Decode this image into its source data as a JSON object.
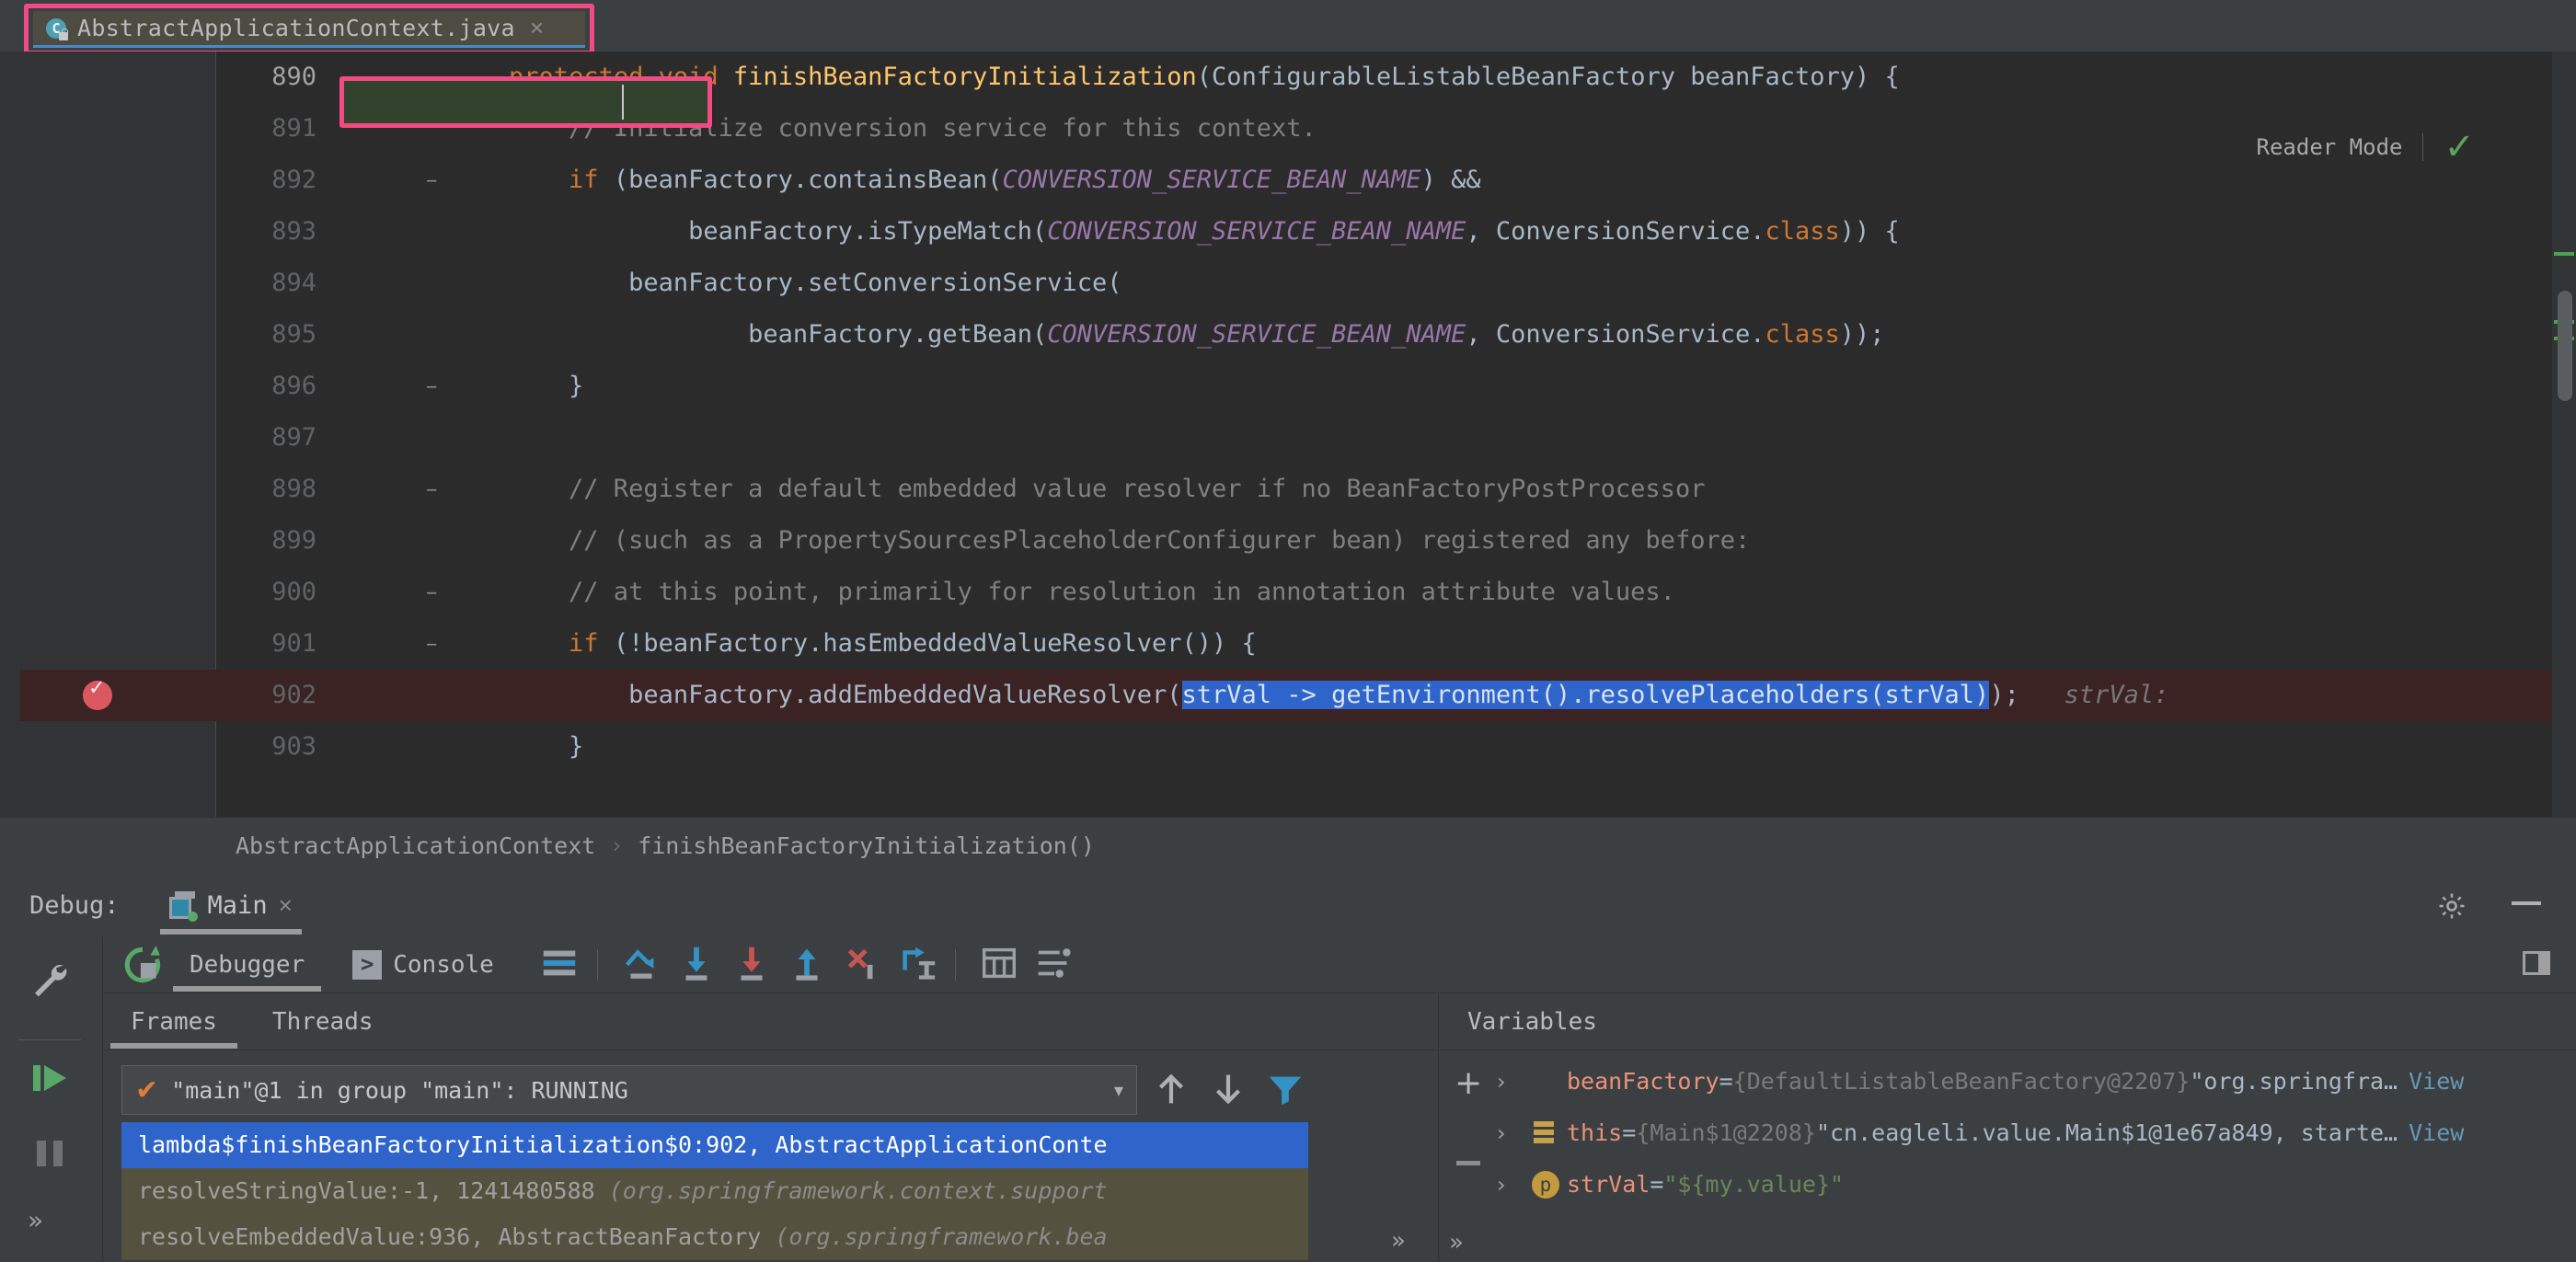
{
  "editor_tab": {
    "filename": "AbstractApplicationContext.java",
    "icon": "java-class-icon",
    "close": "×",
    "highlight_color": "#f24a82"
  },
  "reader_mode": {
    "label": "Reader Mode",
    "check": "✓"
  },
  "code": {
    "highlighted_method": "finishBeanFactoryInitialization",
    "lines": [
      {
        "num": "890",
        "fold": "−",
        "current": true,
        "tokens": [
          {
            "t": "    ",
            "c": "pln"
          },
          {
            "t": "protected void ",
            "c": "kw"
          },
          {
            "t": "finishBeanFactoryInitialization",
            "c": "fn"
          },
          {
            "t": "(ConfigurableListableBeanFactory beanFactory) {",
            "c": "pln"
          }
        ]
      },
      {
        "num": "891",
        "fold": "",
        "tokens": [
          {
            "t": "        // Initialize conversion service for this context.",
            "c": "cm"
          }
        ]
      },
      {
        "num": "892",
        "fold": "−",
        "tokens": [
          {
            "t": "        ",
            "c": "pln"
          },
          {
            "t": "if",
            "c": "kw"
          },
          {
            "t": " (beanFactory.containsBean(",
            "c": "pln"
          },
          {
            "t": "CONVERSION_SERVICE_BEAN_NAME",
            "c": "st"
          },
          {
            "t": ") &&",
            "c": "pln"
          }
        ]
      },
      {
        "num": "893",
        "fold": "",
        "tokens": [
          {
            "t": "                beanFactory.isTypeMatch(",
            "c": "pln"
          },
          {
            "t": "CONVERSION_SERVICE_BEAN_NAME",
            "c": "st"
          },
          {
            "t": ", ConversionService.",
            "c": "pln"
          },
          {
            "t": "class",
            "c": "kw"
          },
          {
            "t": ")) {",
            "c": "pln"
          }
        ]
      },
      {
        "num": "894",
        "fold": "",
        "tokens": [
          {
            "t": "            beanFactory.setConversionService(",
            "c": "pln"
          }
        ]
      },
      {
        "num": "895",
        "fold": "",
        "tokens": [
          {
            "t": "                    beanFactory.getBean(",
            "c": "pln"
          },
          {
            "t": "CONVERSION_SERVICE_BEAN_NAME",
            "c": "st"
          },
          {
            "t": ", ConversionService.",
            "c": "pln"
          },
          {
            "t": "class",
            "c": "kw"
          },
          {
            "t": "));",
            "c": "pln"
          }
        ]
      },
      {
        "num": "896",
        "fold": "−",
        "tokens": [
          {
            "t": "        }",
            "c": "pln"
          }
        ]
      },
      {
        "num": "897",
        "fold": "",
        "tokens": [
          {
            "t": "",
            "c": "pln"
          }
        ]
      },
      {
        "num": "898",
        "fold": "−",
        "tokens": [
          {
            "t": "        // Register a default embedded value resolver if no BeanFactoryPostProcessor",
            "c": "cm"
          }
        ]
      },
      {
        "num": "899",
        "fold": "",
        "tokens": [
          {
            "t": "        // (such as a PropertySourcesPlaceholderConfigurer bean) registered any before:",
            "c": "cm"
          }
        ]
      },
      {
        "num": "900",
        "fold": "−",
        "tokens": [
          {
            "t": "        // at this point, primarily for resolution in annotation attribute values.",
            "c": "cm"
          }
        ]
      },
      {
        "num": "901",
        "fold": "−",
        "tokens": [
          {
            "t": "        ",
            "c": "pln"
          },
          {
            "t": "if",
            "c": "kw"
          },
          {
            "t": " (!beanFactory.hasEmbeddedValueResolver()) {",
            "c": "pln"
          }
        ]
      },
      {
        "num": "902",
        "fold": "",
        "breakpoint": true,
        "tokens": [
          {
            "t": "            beanFactory.addEmbeddedValueResolver(",
            "c": "pln"
          },
          {
            "t": "strVal -> getEnvironment().resolvePlaceholders(strVal)",
            "c": "sel"
          },
          {
            "t": ");",
            "c": "pln"
          },
          {
            "t": "   strVal:",
            "c": "hint"
          }
        ]
      },
      {
        "num": "903",
        "fold": "",
        "tokens": [
          {
            "t": "        }",
            "c": "pln"
          }
        ]
      }
    ]
  },
  "breadcrumb": {
    "items": [
      "AbstractApplicationContext",
      "finishBeanFactoryInitialization()"
    ],
    "separator": "›"
  },
  "debug_header": {
    "label": "Debug:",
    "session_tab": "Main",
    "session_close": "×",
    "settings_icon": "gear-icon",
    "minimize_icon": "minimize-icon"
  },
  "debug_toolbar": {
    "rerun_icon": "rerun-icon",
    "tabs": [
      {
        "label": "Debugger",
        "active": true,
        "icon": ""
      },
      {
        "label": "Console",
        "active": false,
        "icon": "console-icon"
      }
    ],
    "buttons": [
      "layout-settings-icon",
      "step-over-icon",
      "step-into-icon",
      "force-step-into-icon",
      "step-out-icon",
      "drop-frame-icon",
      "run-to-cursor-icon",
      "evaluate-expression-icon",
      "settings-lines-icon"
    ],
    "right_icon": "restore-layout-icon"
  },
  "left_rail": {
    "icons": [
      "wrench-icon",
      "resume-program-icon",
      "pause-program-icon"
    ],
    "more": "»"
  },
  "frames": {
    "tabs": [
      {
        "label": "Frames",
        "active": true
      },
      {
        "label": "Threads",
        "active": false
      }
    ],
    "thread_selector": {
      "check": "✔",
      "text": "\"main\"@1 in group \"main\": RUNNING",
      "arrow": "▾"
    },
    "buttons": [
      "arrow-up-icon",
      "arrow-down-icon",
      "filter-icon"
    ],
    "list": [
      {
        "text": "lambda$finishBeanFactoryInitialization$0:902, AbstractApplicationConte",
        "selected": true,
        "pkg": ""
      },
      {
        "text": "resolveStringValue:-1, 1241480588 ",
        "pkg": "(org.springframework.context.support",
        "selected": false
      },
      {
        "text": "resolveEmbeddedValue:936, AbstractBeanFactory ",
        "pkg": "(org.springframework.bea",
        "selected": false
      }
    ],
    "more": "»"
  },
  "variables": {
    "title": "Variables",
    "add": "+",
    "remove": "−",
    "rows": [
      {
        "chevron": "›",
        "icon": "object-icon",
        "name": "beanFactory",
        "eq": " = ",
        "type": "{DefaultListableBeanFactory@2207}",
        "value": " \"org.springfra…",
        "view": "View"
      },
      {
        "chevron": "›",
        "icon": "this-icon",
        "name": "this",
        "eq": " = ",
        "type": "{Main$1@2208}",
        "value": " \"cn.eagleli.value.Main$1@1e67a849, starte…",
        "view": "View"
      },
      {
        "chevron": "›",
        "icon": "parameter-icon",
        "name": "strVal",
        "eq": " = ",
        "type": "",
        "string": "\"${my.value}\"",
        "view": ""
      }
    ],
    "more": "»"
  },
  "colors": {
    "background": "#3c3f41",
    "editor_bg": "#2b2b2b",
    "gutter_bg": "#313335",
    "accent_pink": "#f24a82",
    "selection_blue": "#2f65ca",
    "keyword_orange": "#cc7832",
    "method_yellow": "#ffc66d",
    "static_purple": "#9876aa",
    "string_green": "#6a8759",
    "comment_gray": "#808080",
    "breakpoint_red": "#db5860",
    "frame_olive": "#55513f"
  }
}
